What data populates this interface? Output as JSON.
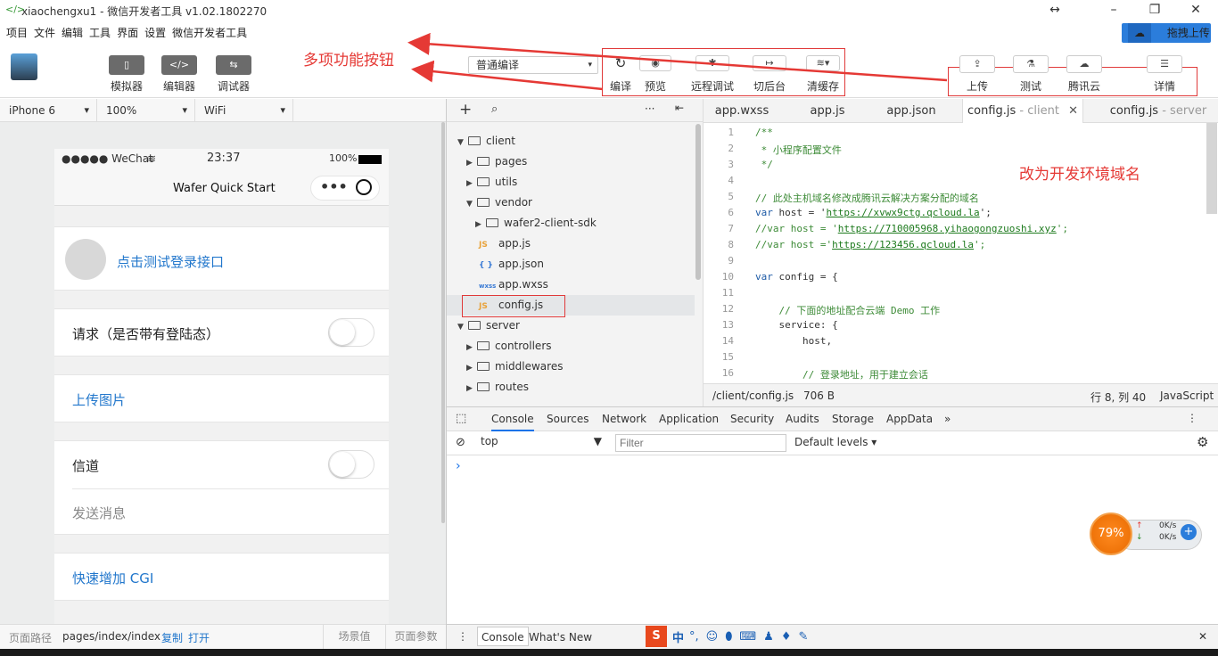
{
  "window": {
    "title": "xiaochengxu1 - 微信开发者工具 v1.02.1802270"
  },
  "menu": [
    "项目",
    "文件",
    "编辑",
    "工具",
    "界面",
    "设置",
    "微信开发者工具"
  ],
  "cloud_button": "拖拽上传",
  "toolbar": {
    "simulator": "模拟器",
    "editor": "编辑器",
    "debugger": "调试器",
    "compile_mode": "普通编译",
    "compile": "编译",
    "preview": "预览",
    "remote_debug": "远程调试",
    "background": "切后台",
    "clear_cache": "清缓存",
    "upload": "上传",
    "test": "测试",
    "tencent_cloud": "腾讯云",
    "details": "详情"
  },
  "annotations": {
    "toolbar_note": "多项功能按钮",
    "domain_note": "改为开发环境域名"
  },
  "device_bar": {
    "device": "iPhone 6",
    "zoom": "100%",
    "network": "WiFi"
  },
  "phone": {
    "signal": "●●●●● WeChat",
    "time": "23:37",
    "battery": "100%",
    "nav_title": "Wafer Quick Start",
    "capsule_dots": "•••",
    "login": "点击测试登录接口",
    "request": "请求（是否带有登陆态）",
    "upload_image": "上传图片",
    "channel": "信道",
    "send_message": "发送消息",
    "add_cgi": "快速增加 CGI"
  },
  "sim_footer": {
    "path_label": "页面路径",
    "path": "pages/index/index",
    "copy": "复制",
    "open": "打开",
    "scene": "场景值",
    "params": "页面参数"
  },
  "tree": {
    "client": "client",
    "pages": "pages",
    "utils": "utils",
    "vendor": "vendor",
    "sdk": "wafer2-client-sdk",
    "app_js": "app.js",
    "app_json": "app.json",
    "app_wxss": "app.wxss",
    "config_js": "config.js",
    "server": "server",
    "controllers": "controllers",
    "middlewares": "middlewares",
    "routes": "routes",
    "js_badge": "JS",
    "json_badge": "{ }",
    "wxss_badge": "wxss",
    "more": "···"
  },
  "tabs": [
    {
      "label": "app.wxss"
    },
    {
      "label": "app.js"
    },
    {
      "label": "app.json"
    },
    {
      "label": "config.js",
      "sub": " - client",
      "close": "✕"
    },
    {
      "label": "config.js",
      "sub": " - server"
    }
  ],
  "code": {
    "line_numbers": [
      "1",
      "2",
      "3",
      "4",
      "5",
      "6",
      "7",
      "8",
      "9",
      "10",
      "11",
      "12",
      "13",
      "14",
      "15",
      "16"
    ],
    "l1": "/**",
    "l2": " * 小程序配置文件",
    "l3": " */",
    "l5": "// 此处主机域名修改成腾讯云解决方案分配的域名",
    "l6a": "var",
    "l6b": " host = '",
    "l6u": "https://xvwx9ctg.qcloud.la",
    "l6c": "';",
    "l7a": "//var host = '",
    "l7u": "https://710005968.yihaogongzuoshi.xyz",
    "l7c": "';",
    "l8a": "//var host ='",
    "l8u": "https://123456.qcloud.la",
    "l8c": "';",
    "l10a": "var",
    "l10b": " config = {",
    "l12": "    // 下面的地址配合云端 Demo 工作",
    "l13": "    service: {",
    "l14": "        host,",
    "l16": "        // 登录地址，用于建立会话"
  },
  "editor_status": {
    "path": "/client/config.js",
    "size": "706 B",
    "position": "行 8, 列 40",
    "language": "JavaScript"
  },
  "devtools": {
    "tabs": [
      "Console",
      "Sources",
      "Network",
      "Application",
      "Security",
      "Audits",
      "Storage",
      "AppData"
    ],
    "more": "»",
    "context": "top",
    "filter_placeholder": "Filter",
    "levels": "Default levels ▾",
    "prompt": "›"
  },
  "drawer": {
    "console": "Console",
    "whats_new": "What's New",
    "close": "✕"
  },
  "ime": {
    "brand": "S",
    "lang": "中",
    "punct": "°,"
  },
  "net_gauge": {
    "percent": "79%",
    "up": "0K/s",
    "down": "0K/s"
  }
}
